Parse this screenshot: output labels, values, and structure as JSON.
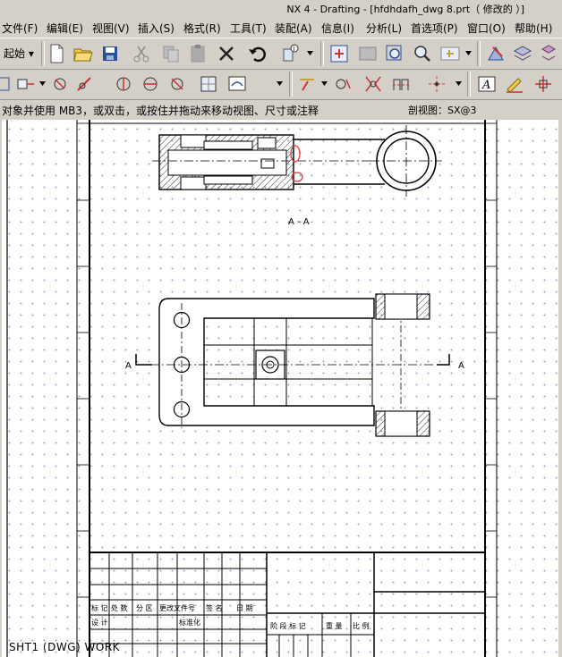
{
  "window": {
    "title": "NX 4 - Drafting - [hfdhdafh_dwg 8.prt（ 修改的 ）]"
  },
  "menu": [
    "文件(F)",
    "编辑(E)",
    "视图(V)",
    "插入(S)",
    "格式(R)",
    "工具(T)",
    "装配(A)",
    "信息(I)",
    "分析(L)",
    "首选项(P)",
    "窗口(O)",
    "帮助(H)"
  ],
  "toolbar": {
    "start_label": "起始"
  },
  "status": {
    "message": "对象并使用 MB3，或双击，或按住并拖动来移动视图、尺寸或注释",
    "section_view": "剖视图：SX@3"
  },
  "drawing": {
    "section_label": "A - A",
    "cut_label_left": "A",
    "cut_label_right": "A",
    "title_block": {
      "row1": [
        "标 记",
        "处 数",
        "分 区",
        "更改文件号",
        "签 名",
        "日 期"
      ],
      "row2_a": "设 计",
      "row2_b": "标准化",
      "row_right": [
        "阶 段 标 记",
        "重 量",
        "比 例"
      ]
    },
    "sheet_status": "SHT1 (DWG) WORK"
  },
  "colors": {
    "markup_red": "#e0393e",
    "grid_dot": "#8fa5c8"
  }
}
